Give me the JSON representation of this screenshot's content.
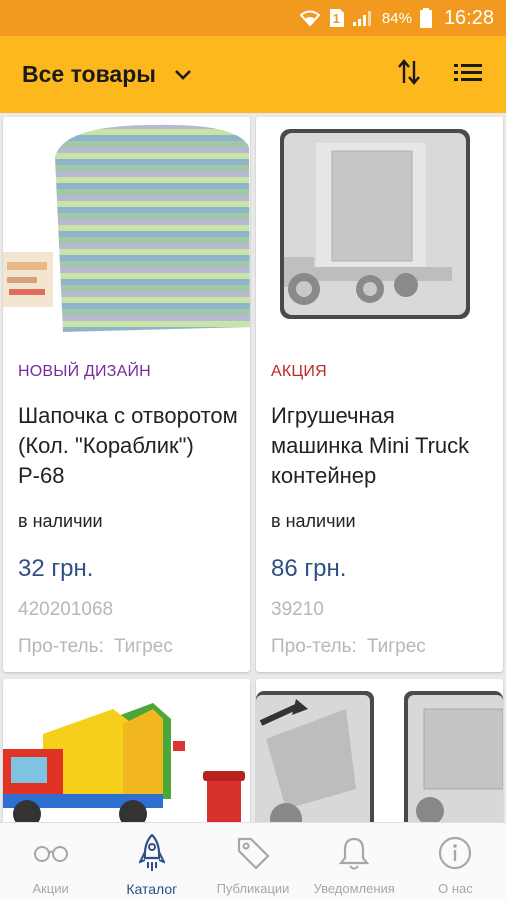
{
  "status_bar": {
    "battery": "84%",
    "time": "16:28",
    "sim": "1"
  },
  "app_bar": {
    "title": "Все товары"
  },
  "products": [
    {
      "tag": "НОВЫЙ ДИЗАЙН",
      "tag_color": "#7a2c9e",
      "title": "Шапочка с отворотом (Кол. \"Кораблик\") Р-68",
      "stock": "в наличии",
      "price": "32 грн.",
      "sku": "420201068",
      "maker_label": "Про-тель:",
      "maker": "Тигрес"
    },
    {
      "tag": "АКЦИЯ",
      "tag_color": "#c0272d",
      "title": "Игрушечная машинка Mini Truck контейнер",
      "stock": "в наличии",
      "price": "86 грн.",
      "sku": "39210",
      "maker_label": "Про-тель:",
      "maker": "Тигрес"
    }
  ],
  "bottom_nav": [
    {
      "label": "Акции",
      "icon": "glasses-icon"
    },
    {
      "label": "Каталог",
      "icon": "rocket-icon"
    },
    {
      "label": "Публикации",
      "icon": "tag-icon"
    },
    {
      "label": "Уведомления",
      "icon": "bell-icon"
    },
    {
      "label": "О нас",
      "icon": "info-icon"
    }
  ],
  "colors": {
    "status_bar": "#f29a1f",
    "app_bar": "#fdb81d",
    "price": "#2f4f85",
    "active_nav": "#2e4f86"
  }
}
